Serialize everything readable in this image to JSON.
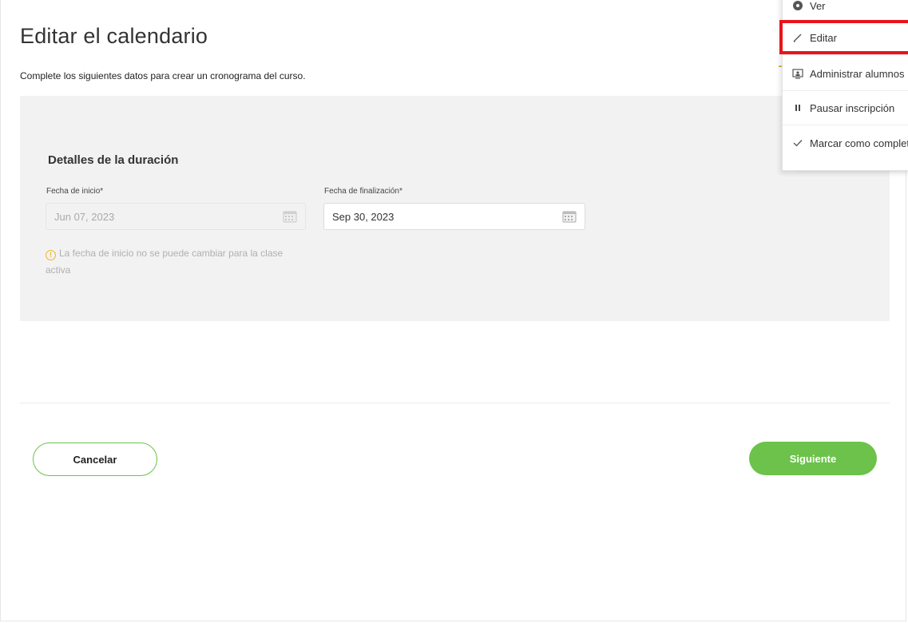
{
  "page": {
    "title": "Editar el calendario",
    "subtitle": "Complete los siguientes datos para crear un cronograma del curso."
  },
  "duration": {
    "section_title": "Detalles de la duración",
    "start_label": "Fecha de inicio*",
    "start_value": "Jun 07, 2023",
    "end_label": "Fecha de finalización*",
    "end_value": "Sep 30, 2023",
    "hint": "La fecha de inicio no se puede cambiar para la clase activa"
  },
  "actions": {
    "cancel_label": "Cancelar",
    "next_label": "Siguiente"
  },
  "menu": {
    "items": [
      {
        "label": "Ver",
        "icon": "eye-icon"
      },
      {
        "label": "Editar",
        "icon": "pencil-icon"
      },
      {
        "label": "Administrar alumnos",
        "icon": "screen-user-icon"
      },
      {
        "label": "Pausar inscripción",
        "icon": "pause-icon"
      },
      {
        "label": "Marcar como completado",
        "icon": "check-icon"
      }
    ]
  },
  "colors": {
    "accent_green": "#6cc24a",
    "highlight_red": "#e8141a",
    "warning_amber": "#f0b429"
  }
}
